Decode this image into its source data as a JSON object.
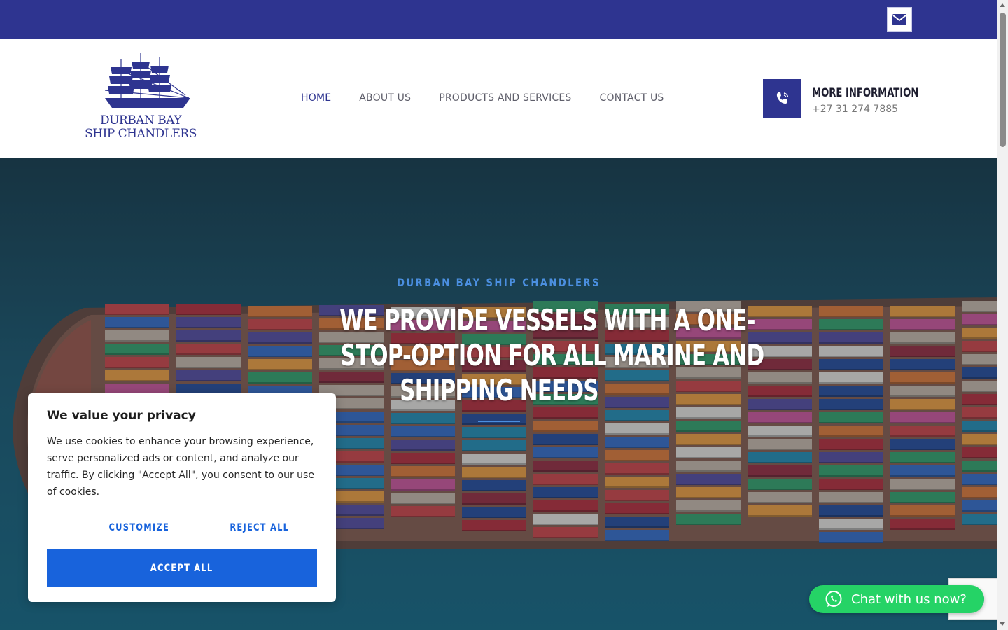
{
  "topbar": {
    "mail_icon": "envelope-icon"
  },
  "logo": {
    "line1": "DURBAN BAY",
    "line2": "SHIP CHANDLERS",
    "icon": "tall-ship-icon"
  },
  "nav": {
    "items": [
      {
        "label": "HOME",
        "active": true
      },
      {
        "label": "ABOUT US",
        "active": false
      },
      {
        "label": "PRODUCTS AND SERVICES",
        "active": false
      },
      {
        "label": "CONTACT US",
        "active": false
      }
    ]
  },
  "contact": {
    "title": "MORE INFORMATION",
    "phone": "+27 31 274 7885",
    "icon": "phone-ringing-icon"
  },
  "hero": {
    "subtitle": "DURBAN BAY SHIP CHANDLERS",
    "title_lines": [
      "WE PROVIDE VESSELS WITH A ONE-",
      "STOP-OPTION FOR ALL MARINE AND",
      "SHIPPING NEEDS"
    ]
  },
  "cookie": {
    "heading": "We value your privacy",
    "body": "We use cookies to enhance your browsing experience, serve personalized ads or content, and analyze our traffic. By clicking \"Accept All\", you consent to our use of cookies.",
    "customize": "CUSTOMIZE",
    "reject": "REJECT ALL",
    "accept": "ACCEPT ALL"
  },
  "chat": {
    "label": "Chat with us now?",
    "icon": "whatsapp-icon"
  },
  "colors": {
    "brand": "#2e3490",
    "accent": "#4b8fe0",
    "cookie_button": "#1863dc",
    "whatsapp": "#25d366"
  }
}
